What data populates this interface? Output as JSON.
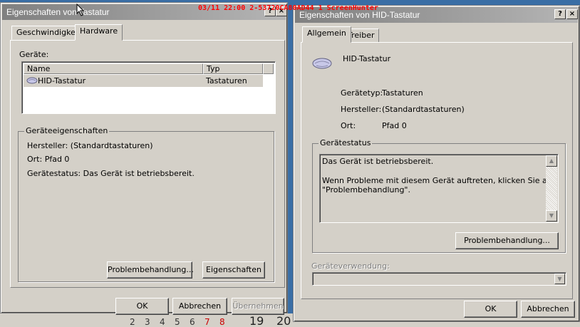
{
  "overlay": {
    "text": "03/11 22:00 2-53720CA80AD44 1 ScreenHunter"
  },
  "desktop": {
    "numbers": [
      "2",
      "3",
      "4",
      "5",
      "6",
      "7",
      "8"
    ],
    "big_numbers": [
      "19",
      "20"
    ]
  },
  "left_window": {
    "title": "Eigenschaften von Tastatur",
    "tabs": [
      "Geschwindigkeit",
      "Hardware"
    ],
    "devices_label": "Geräte:",
    "columns": [
      "Name",
      "Typ"
    ],
    "rows": [
      {
        "name": "HID-Tastatur",
        "type": "Tastaturen"
      }
    ],
    "group_title": "Geräteeigenschaften",
    "manufacturer": "Hersteller: (Standardtastaturen)",
    "location": "Ort: Pfad 0",
    "status": "Gerätestatus: Das Gerät ist betriebsbereit.",
    "troubleshoot_button": "Problembehandlung...",
    "properties_button": "Eigenschaften",
    "ok_button": "OK",
    "cancel_button": "Abbrechen",
    "apply_button": "Übernehmen"
  },
  "right_window": {
    "title": "Eigenschaften von HID-Tastatur",
    "help_button": "?",
    "close_button": "×",
    "tabs": [
      "Allgemein",
      "Treiber"
    ],
    "device_name": "HID-Tastatur",
    "device_type_label": "Gerätetyp:",
    "device_type_value": "Tastaturen",
    "manufacturer_label": "Hersteller:",
    "manufacturer_value": "(Standardtastaturen)",
    "location_label": "Ort:",
    "location_value": "Pfad 0",
    "status_group": "Gerätestatus",
    "status_line1": "Das Gerät ist betriebsbereit.",
    "status_line2": "Wenn Probleme mit diesem Gerät auftreten, klicken Sie auf",
    "status_line3": "\"Problembehandlung\".",
    "troubleshoot_button": "Problembehandlung...",
    "usage_label": "Geräteverwendung:",
    "ok_button": "OK",
    "cancel_button": "Abbrechen"
  }
}
